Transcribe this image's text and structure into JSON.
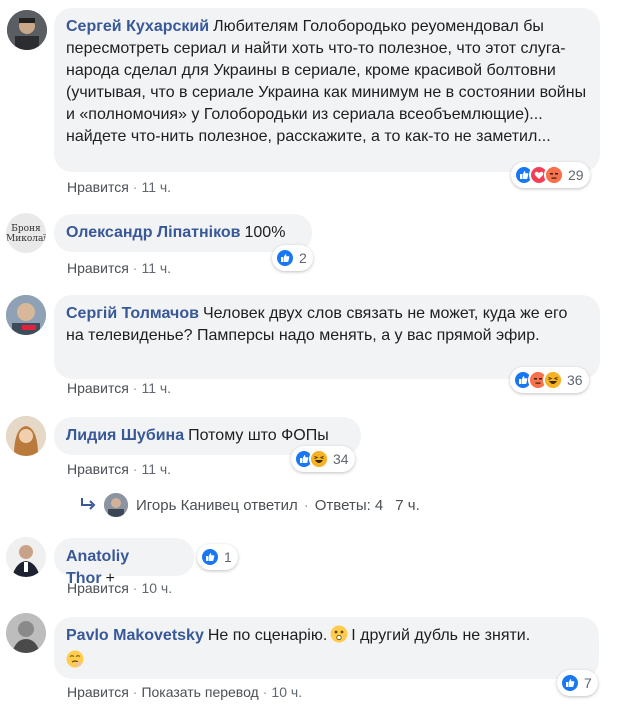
{
  "comments": [
    {
      "author": "Сергей Кухарский",
      "text": "Любителям Голобородько реуомендовал бы пересмотреть сериал и найти хоть что-то полезное, что этот слуга-народа сделал для Украины в сериале, кроме красивой болтовни (учитывая, что в сериале Украина как минимум не в состоянии войны и «полномочия» у Голобородьки из сериала всеобъемлющие)... найдете что-нить полезное, расскажите, а то как-то не заметил...",
      "like": "Нравится",
      "time": "11 ч.",
      "reaction_count": "29",
      "reactions": [
        "like",
        "love",
        "angry"
      ]
    },
    {
      "author": "Олександр Ліпатніков",
      "text": "100%",
      "like": "Нравится",
      "time": "11 ч.",
      "reaction_count": "2",
      "reactions": [
        "like"
      ],
      "avatar_text": "Броня Миколаїв"
    },
    {
      "author": "Сергій Толмачов",
      "text": "Человек двух слов связать не может, куда же его на телевиденье? Памперсы надо менять, а у вас прямой эфир.",
      "like": "Нравится",
      "time": "11 ч.",
      "reaction_count": "36",
      "reactions": [
        "like",
        "angry",
        "haha"
      ]
    },
    {
      "author": "Лидия Шубина",
      "text": "Потому што ФОПы",
      "like": "Нравится",
      "time": "11 ч.",
      "reaction_count": "34",
      "reactions": [
        "like",
        "haha"
      ]
    },
    {
      "author": "Anatoliy Thor",
      "text": "+",
      "like": "Нравится",
      "time": "10 ч.",
      "reaction_count": "1",
      "reactions": [
        "like"
      ]
    },
    {
      "author": "Pavlo Makovetsky",
      "text_line1": "Не по сценарію.",
      "text_line1b": "І другий дубль не зняти.",
      "like": "Нравится",
      "translate": "Показать перевод",
      "time": "10 ч.",
      "reaction_count": "7",
      "reactions": [
        "like"
      ]
    }
  ],
  "reply_thread": {
    "name": "Игорь Канивец ответил",
    "replies": "Ответы: 4",
    "time": "7 ч."
  },
  "colors": {
    "like": "#1877f2",
    "love": "#f33e58",
    "angry": "#e9710f",
    "haha": "#f7b125",
    "author": "#385898"
  }
}
